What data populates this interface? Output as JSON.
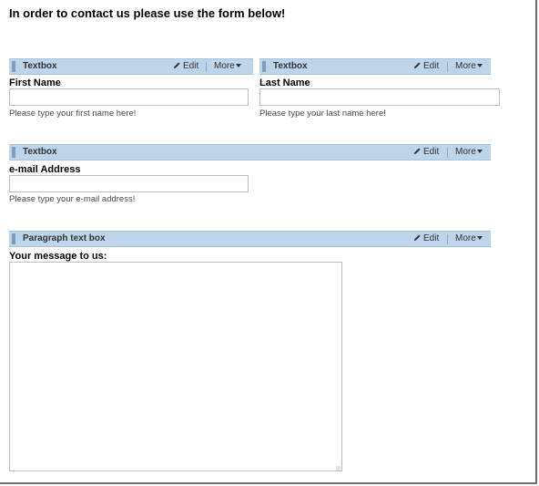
{
  "page": {
    "heading": "In order to contact us please use the form below!"
  },
  "widgets": [
    {
      "title": "Textbox",
      "edit_label": "Edit",
      "more_label": "More",
      "field_label": "First Name",
      "help": "Please type your first name here!",
      "value": ""
    },
    {
      "title": "Textbox",
      "edit_label": "Edit",
      "more_label": "More",
      "field_label": "Last Name",
      "help": "Please type your last name here!",
      "value": ""
    },
    {
      "title": "Textbox",
      "edit_label": "Edit",
      "more_label": "More",
      "field_label": "e-mail Address",
      "help": "Please type your e-mail address!",
      "value": ""
    },
    {
      "title": "Paragraph text box",
      "edit_label": "Edit",
      "more_label": "More",
      "field_label": "Your message to us:",
      "value": ""
    }
  ],
  "icons": {
    "edit": "pencil-icon",
    "more": "caret-down-icon",
    "drag": "drag-handle-icon",
    "resize": "resize-grip-icon"
  },
  "colors": {
    "bar_background": "#bcd5ea",
    "bar_border": "#a7c3dc"
  }
}
